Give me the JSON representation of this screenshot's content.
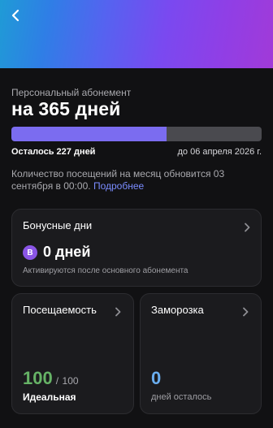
{
  "header": {
    "back_icon": "chevron-left-icon",
    "gradient_colors": [
      "#1f9bd6",
      "#5563f0",
      "#8f3fe6",
      "#a13ad8"
    ]
  },
  "membership": {
    "subtitle": "Персональный абонемент",
    "title": "на 365 дней",
    "progress_percent": 62,
    "remaining_label": "Осталось 227 дней",
    "end_label": "до 06 апреля 2026 г.",
    "visits_note": "Количество посещений на месяц обновится 03 сентября в 00:00.",
    "more_link": "Подробнее"
  },
  "bonus": {
    "title": "Бонусные дни",
    "badge": "B",
    "value": "0 дней",
    "note": "Активируются после основного абонемента"
  },
  "attendance": {
    "title": "Посещаемость",
    "value": "100",
    "separator": "/",
    "max": "100",
    "status": "Идеальная"
  },
  "freeze": {
    "title": "Заморозка",
    "value": "0",
    "note": "дней осталось"
  },
  "colors": {
    "background": "#111113",
    "card": "#1b1b1e",
    "progress_fill": "#7b6cf0",
    "progress_track": "#4a4a4f",
    "link": "#7a8cff",
    "attendance_value": "#66b366",
    "freeze_value": "#6aaef0",
    "badge": "#8a55e6"
  }
}
